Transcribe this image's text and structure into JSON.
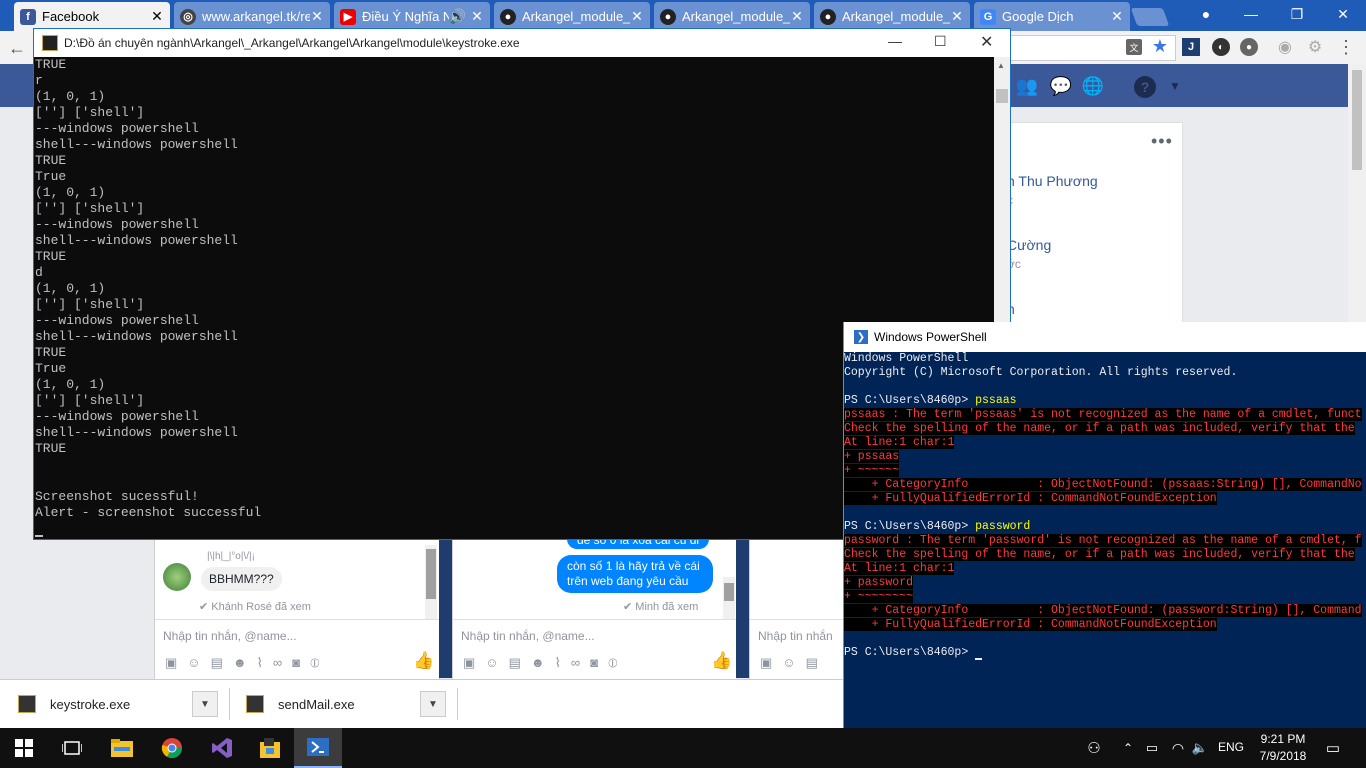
{
  "browser": {
    "tabs": [
      {
        "title": "Facebook",
        "icon": "facebook-icon",
        "active": true
      },
      {
        "title": "www.arkangel.tk/re",
        "icon": "globe-icon"
      },
      {
        "title": "Điều Ý Nghĩa N",
        "icon": "youtube-icon"
      },
      {
        "title": "Arkangel_module_",
        "icon": "github-icon"
      },
      {
        "title": "Arkangel_module_",
        "icon": "github-icon"
      },
      {
        "title": "Arkangel_module_",
        "icon": "github-icon"
      },
      {
        "title": "Google Dịch",
        "icon": "google-translate-icon"
      }
    ]
  },
  "facebook": {
    "friends": [
      {
        "name": "n Thu Phương",
        "sub": "c"
      },
      {
        "name": "Cường",
        "sub": "ớc"
      },
      {
        "name": "n",
        "sub": ""
      }
    ],
    "chats": [
      {
        "sender": "|\\|h|_|°o|\\/|¡",
        "message": "BBHMM???",
        "seen": "Khánh Rosé đã xem",
        "placeholder": "Nhập tin nhắn, @name..."
      },
      {
        "message_partial": "để số 0 là xóa cái cũ đi",
        "message": "còn số 1 là hãy trả về cái trên web đang yêu cầu",
        "seen": "Minh đã xem",
        "placeholder": "Nhập tin nhắn, @name..."
      },
      {
        "placeholder": "Nhập tin nhắn"
      }
    ]
  },
  "downloads": [
    {
      "name": "keystroke.exe"
    },
    {
      "name": "sendMail.exe"
    }
  ],
  "console": {
    "title": "D:\\Đồ án chuyên ngành\\Arkangel\\_Arkangel\\Arkangel\\Arkangel\\module\\keystroke.exe",
    "lines": [
      "TRUE",
      "r",
      "(1, 0, 1)",
      "[''] ['shell']",
      "---windows powershell",
      "shell---windows powershell",
      "TRUE",
      "True",
      "(1, 0, 1)",
      "[''] ['shell']",
      "---windows powershell",
      "shell---windows powershell",
      "TRUE",
      "d",
      "(1, 0, 1)",
      "[''] ['shell']",
      "---windows powershell",
      "shell---windows powershell",
      "TRUE",
      "True",
      "(1, 0, 1)",
      "[''] ['shell']",
      "---windows powershell",
      "shell---windows powershell",
      "TRUE",
      "",
      "",
      "Screenshot sucessful!",
      "Alert - screenshot successful"
    ]
  },
  "powershell": {
    "title": "Windows PowerShell",
    "lines": [
      {
        "text": "Windows PowerShell",
        "style": "normal"
      },
      {
        "text": "Copyright (C) Microsoft Corporation. All rights reserved.",
        "style": "normal"
      },
      {
        "text": "",
        "style": "normal"
      },
      {
        "prompt": "PS C:\\Users\\8460p> ",
        "cmd": "pssaas",
        "style": "prompt"
      },
      {
        "text": "pssaas : The term 'pssaas' is not recognized as the name of a cmdlet, funct",
        "style": "error"
      },
      {
        "text": "Check the spelling of the name, or if a path was included, verify that the",
        "style": "error"
      },
      {
        "text": "At line:1 char:1",
        "style": "error"
      },
      {
        "text": "+ pssaas",
        "style": "error"
      },
      {
        "text": "+ ~~~~~~",
        "style": "error"
      },
      {
        "text": "    + CategoryInfo          : ObjectNotFound: (pssaas:String) [], CommandNo",
        "style": "error"
      },
      {
        "text": "    + FullyQualifiedErrorId : CommandNotFoundException",
        "style": "error"
      },
      {
        "text": "",
        "style": "normal"
      },
      {
        "prompt": "PS C:\\Users\\8460p> ",
        "cmd": "password",
        "style": "prompt"
      },
      {
        "text": "password : The term 'password' is not recognized as the name of a cmdlet, f",
        "style": "error"
      },
      {
        "text": "Check the spelling of the name, or if a path was included, verify that the",
        "style": "error"
      },
      {
        "text": "At line:1 char:1",
        "style": "error"
      },
      {
        "text": "+ password",
        "style": "error"
      },
      {
        "text": "+ ~~~~~~~~",
        "style": "error"
      },
      {
        "text": "    + CategoryInfo          : ObjectNotFound: (password:String) [], Command",
        "style": "error"
      },
      {
        "text": "    + FullyQualifiedErrorId : CommandNotFoundException",
        "style": "error"
      },
      {
        "text": "",
        "style": "normal"
      },
      {
        "prompt": "PS C:\\Users\\8460p> ",
        "cmd": "",
        "style": "prompt"
      }
    ]
  },
  "taskbar": {
    "language": "ENG",
    "time": "9:21 PM",
    "date": "7/9/2018"
  },
  "colors": {
    "chrome_tabstrip": "#1f5cb8",
    "facebook_blue": "#3b5998",
    "console_bg": "#0c0c0c",
    "powershell_bg": "#012456",
    "error_red": "#ff3a3a",
    "messenger_blue": "#0084ff"
  }
}
